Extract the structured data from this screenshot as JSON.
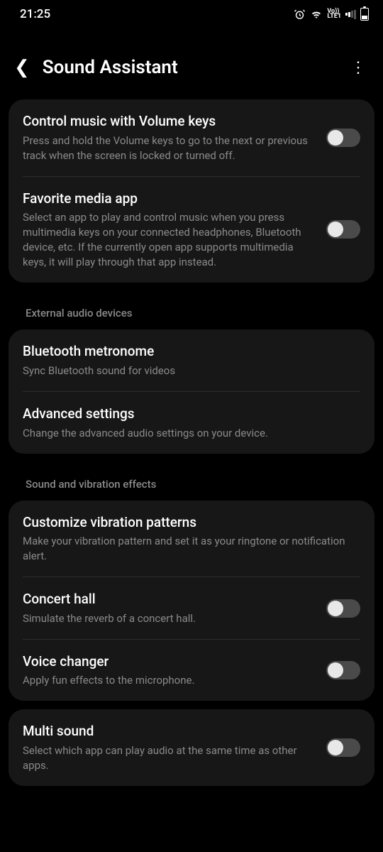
{
  "status": {
    "time": "21:25",
    "volte": "Vo))\nLTE1"
  },
  "header": {
    "title": "Sound Assistant"
  },
  "groups": [
    {
      "items": [
        {
          "title": "Control music with Volume keys",
          "desc": "Press and hold the Volume keys to go to the next or previous track when the screen is locked or turned off.",
          "toggle": true,
          "on": false
        },
        {
          "title": "Favorite media app",
          "desc": "Select an app to play and control music when you press multimedia keys on your connected headphones, Bluetooth device, etc. If the currently open app supports multimedia keys, it will play through that app instead.",
          "toggle": true,
          "on": false
        }
      ]
    },
    {
      "header": "External audio devices",
      "items": [
        {
          "title": "Bluetooth metronome",
          "desc": "Sync Bluetooth sound for videos",
          "toggle": false
        },
        {
          "title": "Advanced settings",
          "desc": "Change the advanced audio settings on your device.",
          "toggle": false
        }
      ]
    },
    {
      "header": "Sound and vibration effects",
      "items": [
        {
          "title": "Customize vibration patterns",
          "desc": "Make your vibration pattern and set it as your ringtone or notification alert.",
          "toggle": false
        },
        {
          "title": "Concert hall",
          "desc": "Simulate the reverb of a concert hall.",
          "toggle": true,
          "on": false
        },
        {
          "title": "Voice changer",
          "desc": "Apply fun effects to the microphone.",
          "toggle": true,
          "on": false
        }
      ]
    },
    {
      "items": [
        {
          "title": "Multi sound",
          "desc": "Select which app can play audio at the same time as other apps.",
          "toggle": true,
          "on": false
        }
      ]
    }
  ]
}
